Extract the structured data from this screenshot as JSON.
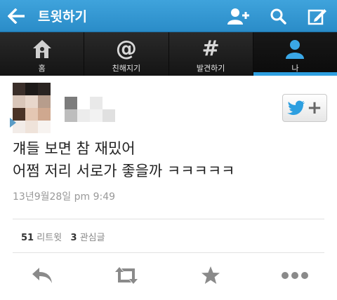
{
  "appbar": {
    "title": "트윗하기",
    "accent": "#2d9fe0"
  },
  "tabs": [
    {
      "label": "홈",
      "icon": "home-icon",
      "active": false
    },
    {
      "label": "친해지기",
      "icon": "at-icon",
      "active": false
    },
    {
      "label": "발견하기",
      "icon": "hash-icon",
      "active": false
    },
    {
      "label": "나",
      "icon": "person-icon",
      "active": true
    }
  ],
  "tab_glyphs": {
    "at": "@",
    "hash": "#"
  },
  "tweet": {
    "line1": "걔들 보면 참 재밌어",
    "line2": "어쩜 저리 서로가 좋을까 ㅋㅋㅋㅋㅋ",
    "timestamp": "13년9월28일 pm 9:49",
    "follow_plus": "+"
  },
  "stats": {
    "retweets_count": "51",
    "retweets_label": "리트윗",
    "favorites_count": "3",
    "favorites_label": "관심글"
  },
  "actions": [
    "reply-icon",
    "retweet-icon",
    "favorite-star-icon",
    "more-icon"
  ]
}
